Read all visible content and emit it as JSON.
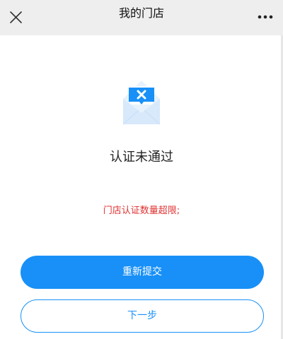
{
  "header": {
    "title": "我的门店",
    "close_icon": "close-icon",
    "more_icon": "more-icon"
  },
  "status": {
    "illustration": "envelope-error-icon",
    "title": "认证未通过",
    "reason": "门店认证数量超限;"
  },
  "actions": {
    "resubmit_label": "重新提交",
    "next_label": "下一步"
  },
  "colors": {
    "accent": "#1890f7",
    "error": "#e03131"
  }
}
